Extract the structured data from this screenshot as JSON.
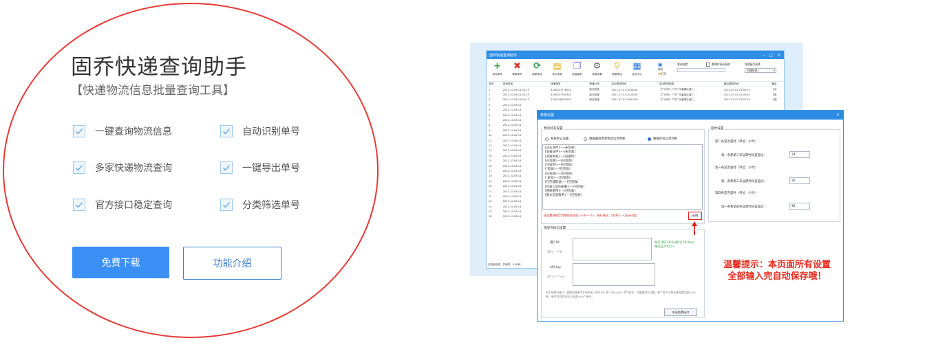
{
  "product": {
    "title": "固乔快递查询助手",
    "subtitle": "【快递物流信息批量查询工具】"
  },
  "features": [
    "一键查询物流信息",
    "自动识别单号",
    "多家快递物流查询",
    "一键导出单号",
    "官方接口稳定查询",
    "分类筛选单号"
  ],
  "buttons": {
    "download": "免费下载",
    "intro": "功能介绍"
  },
  "colors": {
    "primary": "#3b8ff5",
    "outline": "#3b7ecc",
    "annotation_red": "#e53935",
    "window_title": "#2f8ee6"
  },
  "screenshot": {
    "main_window": {
      "title": "固乔快递查询助手",
      "toolbar": [
        {
          "label": "添加单号",
          "icon": "plus-icon",
          "color": "#2ea043",
          "glyph": "+"
        },
        {
          "label": "删除单号",
          "icon": "delete-icon",
          "color": "#d9342b",
          "glyph": "✖"
        },
        {
          "label": "刷新物流",
          "icon": "refresh-icon",
          "color": "#2e9b4a",
          "glyph": "⟳"
        },
        {
          "label": "导出表格",
          "icon": "export-icon",
          "color": "#e6a817",
          "glyph": "▤"
        },
        {
          "label": "批量复制",
          "icon": "copy-icon",
          "color": "#8a6fd1",
          "glyph": "❐"
        },
        {
          "label": "参数设置",
          "icon": "gear-icon",
          "color": "#666666",
          "glyph": "⚙"
        },
        {
          "label": "数据筛选",
          "icon": "filter-icon",
          "color": "#e6b81e",
          "glyph": "⚲"
        },
        {
          "label": "会员中心",
          "icon": "member-icon",
          "color": "#2f7ad8",
          "glyph": "▦"
        }
      ],
      "save_label": "保存",
      "open_label": "打开",
      "progress_label": "查询进度",
      "auto_option": "查询时滚动表格",
      "api_label": "快递接口选择",
      "api_value": "四通快递1",
      "columns": [
        "序号",
        "查询时间",
        "快递单号",
        "快递公司",
        "发出物流时间",
        "发出物流信息",
        "最后更新时间",
        "最后"
      ],
      "rows": [
        [
          "1",
          "2021-10-08 14:33:15",
          "4200207776042",
          "韵达快递",
          "2021-07-01 00:36:45",
          "【广州市】广东广州番禺区曾仁...",
          "2021-07-02 23:03:10",
          "【北"
        ],
        [
          "2",
          "2021-10-08 14:33:15",
          "4200207761943",
          "韵达快递",
          "2021-07-01 01:06:30",
          "【广州市】广东广州番禺区曾仁...",
          "2021-07-02 12:04:41",
          "【蔡"
        ],
        [
          "3",
          "2021-10-08 14:33:15",
          "4200208067591",
          "韵达快递",
          "2021-07-01 00:49:59",
          "【广州市】广东广州番禺区曾仁...",
          "2021-07-02 19:01:52",
          "【湘"
        ],
        [
          "4",
          "2021-10-08 14",
          "",
          "",
          "",
          "",
          "",
          ""
        ],
        [
          "5",
          "2021-10-08 14",
          "",
          "",
          "",
          "",
          "",
          ""
        ],
        [
          "6",
          "2021-10-08 14",
          "",
          "",
          "",
          "",
          "",
          ""
        ],
        [
          "7",
          "2021-10-08 14",
          "",
          "",
          "",
          "",
          "",
          ""
        ],
        [
          "8",
          "2021-10-08 14",
          "",
          "",
          "",
          "",
          "",
          ""
        ],
        [
          "9",
          "2021-10-08 14",
          "",
          "",
          "",
          "",
          "",
          ""
        ],
        [
          "10",
          "2021-10-08 14",
          "",
          "",
          "",
          "",
          "",
          ""
        ],
        [
          "11",
          "2021-10-08 14",
          "",
          "",
          "",
          "",
          "",
          ""
        ],
        [
          "12",
          "2021-10-08 14",
          "",
          "",
          "",
          "",
          "",
          ""
        ],
        [
          "13",
          "2021-10-08 14",
          "",
          "",
          "",
          "",
          "",
          ""
        ],
        [
          "14",
          "2021-10-08 14",
          "",
          "",
          "",
          "",
          "",
          ""
        ],
        [
          "15",
          "2021-10-08 14",
          "",
          "",
          "",
          "",
          "",
          ""
        ],
        [
          "16",
          "2021-10-08 14",
          "",
          "",
          "",
          "",
          "",
          ""
        ],
        [
          "17",
          "2021-10-08 14",
          "",
          "",
          "",
          "",
          "",
          ""
        ],
        [
          "18",
          "2021-10-08 14",
          "",
          "",
          "",
          "",
          "",
          ""
        ],
        [
          "19",
          "2021-10-08 14",
          "",
          "",
          "",
          "",
          "",
          ""
        ],
        [
          "20",
          "2021-10-08 14",
          "",
          "",
          "",
          "",
          "",
          ""
        ],
        [
          "21",
          "2021-10-08 14",
          "",
          "",
          "",
          "",
          "",
          ""
        ],
        [
          "22",
          "2021-10-08 14",
          "",
          "",
          "",
          "",
          "",
          ""
        ],
        [
          "23",
          "2021-10-08 14",
          "",
          "",
          "",
          "",
          "",
          ""
        ],
        [
          "24",
          "2021-10-08 14",
          "",
          "",
          "",
          "",
          "",
          ""
        ],
        [
          "25",
          "2021-10-08 14",
          "",
          "",
          "",
          "",
          "",
          ""
        ],
        [
          "26",
          "2021-10-08 14",
          "",
          "",
          "",
          "",
          "",
          ""
        ]
      ],
      "status": "已查询完成，共耗时：0.84秒"
    },
    "settings_window": {
      "title": "参数设置",
      "status_group": "物流状态设置",
      "radios": [
        {
          "label": "系统默认设置",
          "checked": false
        },
        {
          "label": "根据最后更新物流信息判断",
          "checked": false
        },
        {
          "label": "根据所有信息判断",
          "checked": true
        }
      ],
      "rules": [
        "[正在派件]----[未签收]",
        "[准备派件]----[未签收]",
        "[签收失败]----[问题件]",
        "[已签收]----[已签收]",
        "[已投柜]----[已签收]",
        "[ 签收]----[已签收]",
        "[已签收]----[已签收]",
        "[ 妥投]----[已签收]",
        "[已完成配送]----[已签收]",
        "[已投入您的邮箱]----[已签收]",
        "[感谢使用]----[已签收]",
        "[图文信息服务]----[已签收]"
      ],
      "rule_hint": "请设置关键字判断物流状态（一行一个），每行格式：[条件]----[显示内容]",
      "example_button": "示例",
      "timeout_group": "超时设置",
      "timeouts": [
        {
          "heading": "第二条是否超时（单位：小时）",
          "label": "第一条和第二条运转时间差超过：",
          "value": "24"
        },
        {
          "heading": "第三条是否超时（单位：小时）",
          "label": "第一条和第三条运转时间差超过：",
          "value": "36"
        },
        {
          "heading": "第四条是否超时（单位：小时）",
          "label": "第一条和第四条运转时间差超过：",
          "value": "48"
        }
      ],
      "api_group": "快递鸟接口设置",
      "user_id_label": "用户ID：",
      "user_id_placeholder": "每行一个ID",
      "api_key_label": "API key：",
      "api_key_placeholder": "每行一个key",
      "api_note": "每行[用户ID]与每行[API key]相对应才可以~",
      "api_footer": "关于快递鸟接口：需要到快递鸟平台申请【用户ID】和【API key】两个账号，才能使用本功能；每个用户ID每天查询限定量3000单，单号识别相关可以开通3000个单号。",
      "apply_button": "申请免费接口"
    },
    "warm_tip_line1": "温馨提示：本页面所有设置",
    "warm_tip_line2": "全部输入完自动保存哦！"
  }
}
